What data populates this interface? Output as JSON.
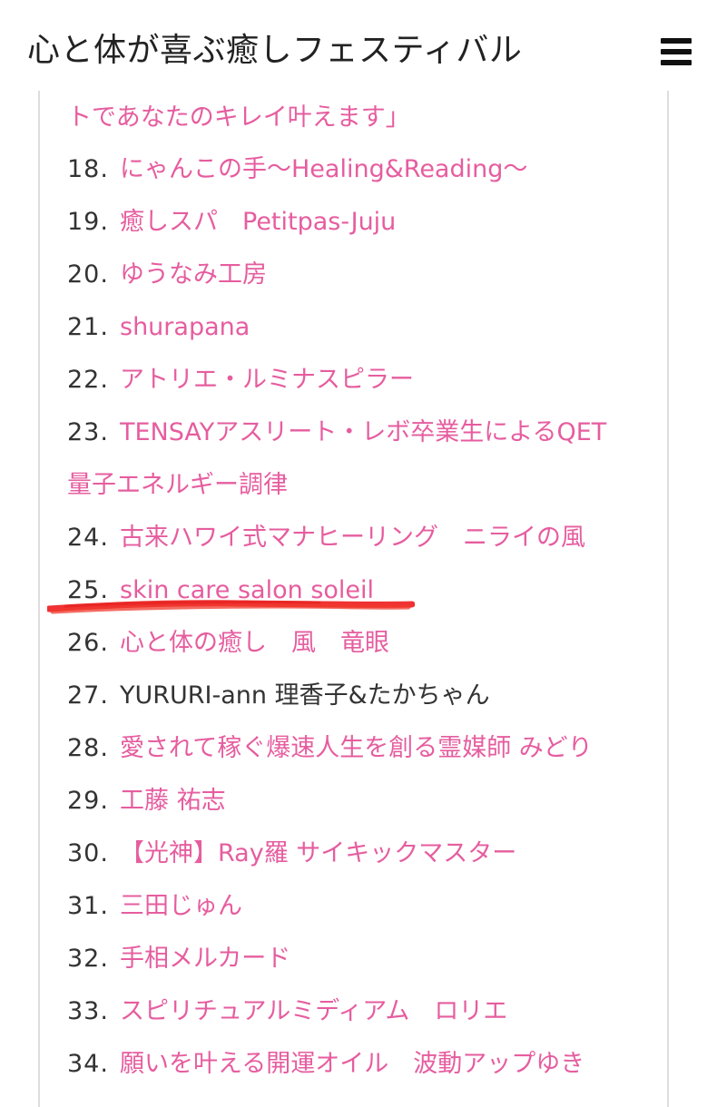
{
  "header": {
    "site_title": "心と体が喜ぶ癒しフェスティバル",
    "menu_icon": "hamburger-menu-icon"
  },
  "list": {
    "continuation_text": "トであなたのキレイ叶えます」",
    "items": [
      {
        "number": "18.",
        "label": "にゃんこの手〜Healing&Reading〜",
        "linked": true
      },
      {
        "number": "19.",
        "label": "癒しスパ　Petitpas-Juju",
        "linked": true
      },
      {
        "number": "20.",
        "label": "ゆうなみ工房",
        "linked": true
      },
      {
        "number": "21.",
        "label": "shurapana",
        "linked": true
      },
      {
        "number": "22.",
        "label": "アトリエ・ルミナスピラー",
        "linked": true
      },
      {
        "number": "23.",
        "label": "TENSAYアスリート・レボ卒業生によるQET",
        "label_line2": "量子エネルギー調律",
        "linked": true
      },
      {
        "number": "24.",
        "label": "古来ハワイ式マナヒーリング　ニライの風",
        "linked": true
      },
      {
        "number": "25.",
        "label": "skin care salon soleil",
        "linked": true
      },
      {
        "number": "26.",
        "label": "心と体の癒し　風　竜眼",
        "linked": true
      },
      {
        "number": "27.",
        "label": "YURURI-ann 理香子&たかちゃん",
        "linked": false
      },
      {
        "number": "28.",
        "label": "愛されて稼ぐ爆速人生を創る霊媒師 みどり",
        "linked": true
      },
      {
        "number": "29.",
        "label": "工藤 祐志",
        "linked": true
      },
      {
        "number": "30.",
        "label": "【光神】Ray羅 サイキックマスター",
        "linked": true
      },
      {
        "number": "31.",
        "label": "三田じゅん",
        "linked": true
      },
      {
        "number": "32.",
        "label": "手相メルカード",
        "linked": true
      },
      {
        "number": "33.",
        "label": "スピリチュアルミディアム　ロリエ",
        "linked": true
      },
      {
        "number": "34.",
        "label": "願いを叶える開運オイル　波動アップゆき",
        "linked": true
      }
    ]
  },
  "colors": {
    "link": "#e65d9f",
    "text": "#333333",
    "highlight_stroke": "#ee1c1c"
  }
}
